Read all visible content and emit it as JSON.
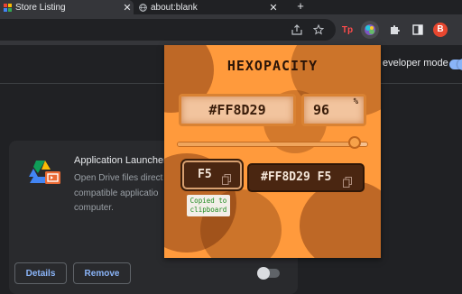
{
  "tabs": [
    {
      "title": "Store Listing",
      "active": true
    },
    {
      "title": "about:blank",
      "active": false
    }
  ],
  "toolbar": {
    "extension_badge": "Tp",
    "avatar_initial": "B"
  },
  "extensions_page": {
    "developer_mode_label": "eveloper mode",
    "developer_mode_on": true,
    "card": {
      "title": "Application Launcher",
      "description_lines": [
        "Open Drive files direct",
        "compatible applicatio",
        "computer."
      ],
      "details_label": "Details",
      "remove_label": "Remove",
      "enabled": false
    }
  },
  "popup": {
    "title": "HEXOPACITY",
    "hex_value": "#FF8D29",
    "opacity_value": "96",
    "opacity_unit": "%",
    "opacity_percent": 96,
    "alpha_hex": "F5",
    "full_hex": "#FF8D29 F5",
    "tooltip_lines": [
      "Copied to",
      "clipboard"
    ]
  },
  "colors": {
    "popup_background": "#ff9a3c",
    "accent_blue": "#8ab4f8",
    "dark_box": "#4a2611",
    "avatar": "#e8472f"
  }
}
